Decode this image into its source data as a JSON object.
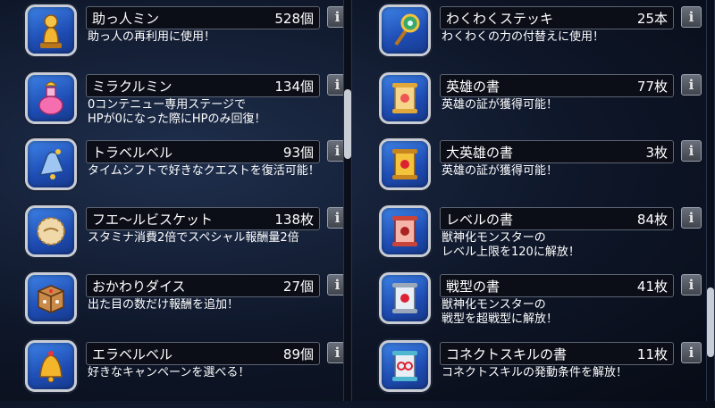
{
  "left_items": [
    {
      "icon": "golden-figurine-icon",
      "name": "助っ人ミン",
      "count": "528個",
      "desc": [
        "助っ人の再利用に使用！"
      ]
    },
    {
      "icon": "heart-potion-icon",
      "name": "ミラクルミン",
      "count": "134個",
      "desc": [
        "0コンテニュー専用ステージで",
        "HPが0になった際にHPのみ回復！"
      ]
    },
    {
      "icon": "blue-bell-icon",
      "name": "トラベルベル",
      "count": "93個",
      "desc": [
        "タイムシフトで好きなクエストを復活可能！"
      ]
    },
    {
      "icon": "biscuit-icon",
      "name": "フエ〜ルビスケット",
      "count": "138枚",
      "desc": [
        "スタミナ消費2倍でスペシャル報酬量2倍"
      ]
    },
    {
      "icon": "dice-icon",
      "name": "おかわりダイス",
      "count": "27個",
      "desc": [
        "出た目の数だけ報酬を追加！"
      ]
    },
    {
      "icon": "golden-bell-icon",
      "name": "エラベルベル",
      "count": "89個",
      "desc": [
        "好きなキャンペーンを選べる！"
      ]
    }
  ],
  "right_items": [
    {
      "icon": "magic-wand-icon",
      "name": "わくわくステッキ",
      "count": "25本",
      "desc": [
        "わくわくの力の付替えに使用！"
      ]
    },
    {
      "icon": "hero-scroll-icon",
      "name": "英雄の書",
      "count": "77枚",
      "desc": [
        "英雄の証が獲得可能！"
      ]
    },
    {
      "icon": "great-hero-scroll-icon",
      "name": "大英雄の書",
      "count": "3枚",
      "desc": [
        "英雄の証が獲得可能！"
      ]
    },
    {
      "icon": "level-scroll-icon",
      "name": "レベルの書",
      "count": "84枚",
      "desc": [
        "獣神化モンスターの",
        "レベル上限を120に解放！"
      ]
    },
    {
      "icon": "battle-type-scroll-icon",
      "name": "戦型の書",
      "count": "41枚",
      "desc": [
        "獣神化モンスターの",
        "戦型を超戦型に解放！"
      ]
    },
    {
      "icon": "connect-skill-scroll-icon",
      "name": "コネクトスキルの書",
      "count": "11枚",
      "desc": [
        "コネクトスキルの発動条件を解放！"
      ]
    }
  ],
  "info_label": "i"
}
